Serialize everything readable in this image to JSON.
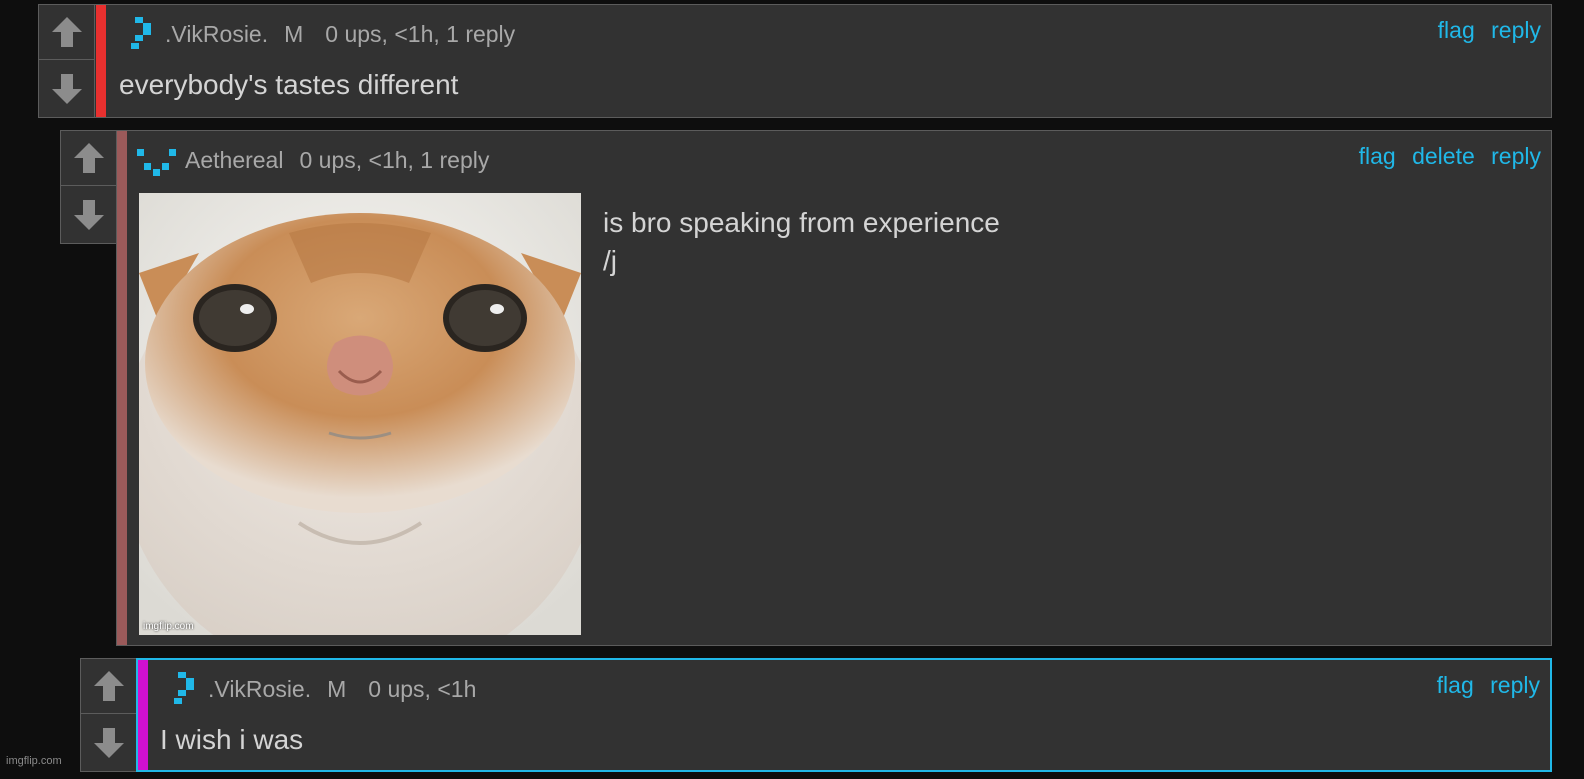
{
  "comments": [
    {
      "username": ".VikRosie.",
      "mod_badge": "M",
      "stats": "0 ups, <1h, 1 reply",
      "actions": [
        "flag",
        "reply"
      ],
      "text": "everybody's tastes different",
      "stripe_color": "#e8302f"
    },
    {
      "username": "Aethereal",
      "stats": "0 ups, <1h, 1 reply",
      "actions": [
        "flag",
        "delete",
        "reply"
      ],
      "text_lines": [
        "is bro speaking from experience",
        "/j"
      ],
      "image_watermark": "imgflip.com",
      "stripe_color": "#9b5a5a"
    },
    {
      "username": ".VikRosie.",
      "mod_badge": "M",
      "stats": "0 ups, <1h",
      "actions": [
        "flag",
        "reply"
      ],
      "text": "I wish i was",
      "stripe_color": "#d010d0",
      "border_color": "#20b8e8"
    }
  ],
  "site_watermark": "imgflip.com",
  "colors": {
    "accent": "#20b8e8",
    "panel": "#323232",
    "background": "#0e0e0e"
  }
}
